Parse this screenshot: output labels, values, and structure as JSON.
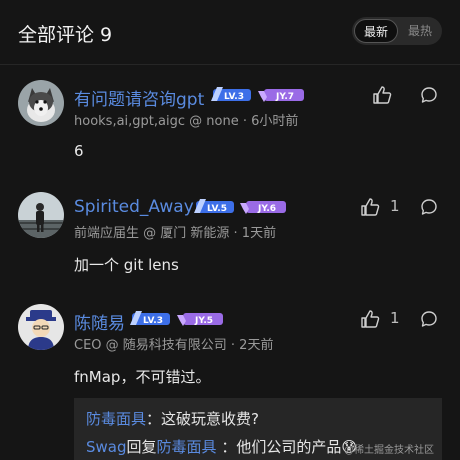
{
  "header": {
    "title": "全部评论 9",
    "sort_latest": "最新",
    "sort_hot": "最热"
  },
  "comments": [
    {
      "name": "有问题请咨询gpt",
      "lv": "LV.3",
      "jy": "JY.7",
      "meta": "hooks,ai,gpt,aigc @ none · 6小时前",
      "content": "6",
      "likes": ""
    },
    {
      "name": "Spirited_Away",
      "lv": "LV.5",
      "jy": "JY.6",
      "meta": "前端应届生 @ 厦门 新能源 · 1天前",
      "content": "加一个 git lens",
      "likes": "1"
    },
    {
      "name": "陈随易",
      "lv": "LV.3",
      "jy": "JY.5",
      "meta": "CEO @ 随易科技有限公司 · 2天前",
      "content": "fnMap，不可错过。",
      "likes": "1"
    }
  ],
  "replies": [
    {
      "name": "防毒面具",
      "connector": "",
      "target": "",
      "text": "：这破玩意收费?"
    },
    {
      "name": "Swag",
      "connector": "回复",
      "target": "防毒面具",
      "text": " ：他们公司的产品😰"
    }
  ],
  "watermark": "@稀土掘金技术社区",
  "colors": {
    "accent": "#5a8be0",
    "background": "#151515",
    "level_badge": "#3d6fe8",
    "jy_badge": "#9a6be6"
  }
}
